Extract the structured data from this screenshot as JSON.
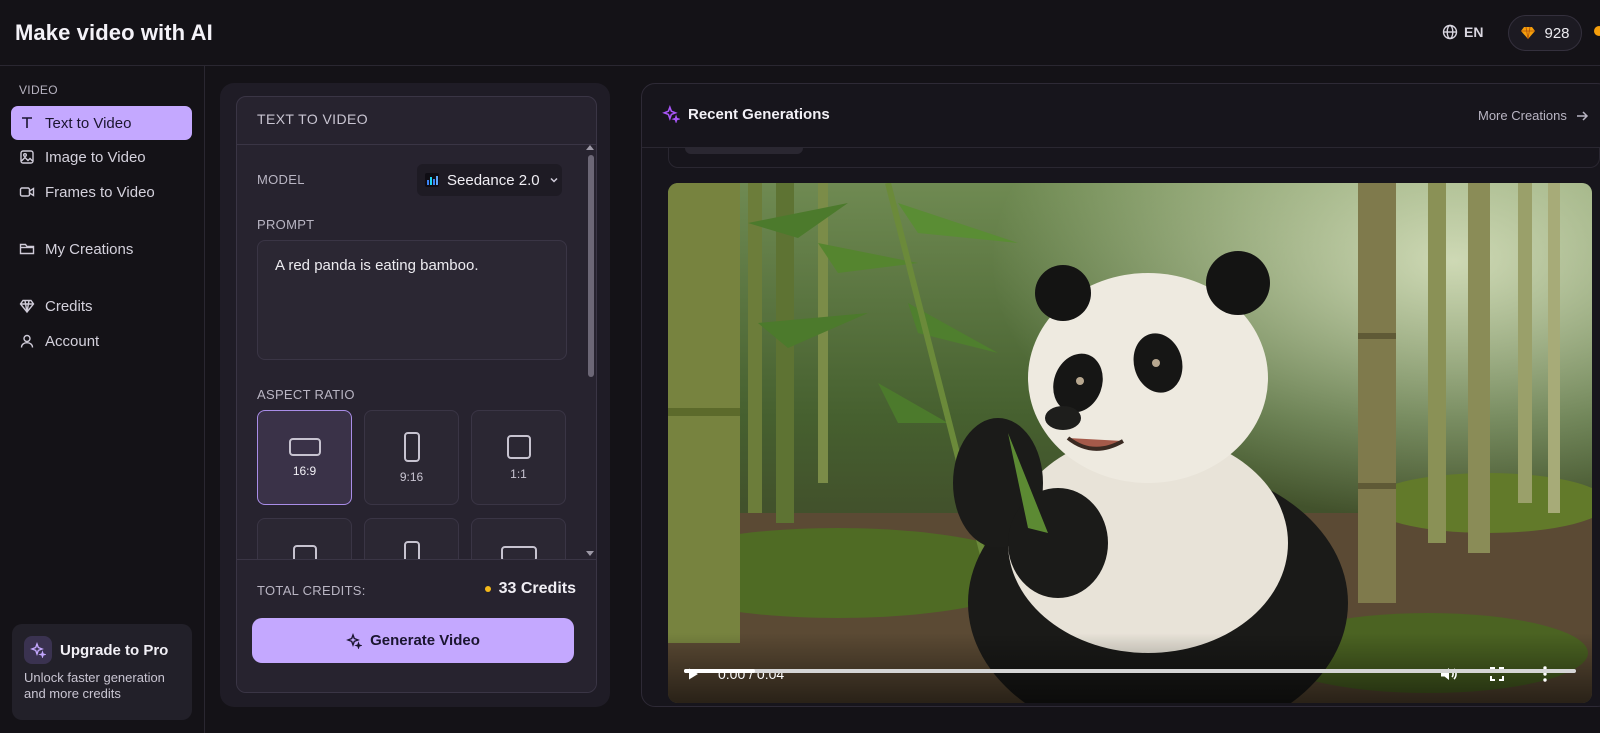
{
  "header": {
    "title": "Make video with AI",
    "language": "EN",
    "credits_balance": "928"
  },
  "sidebar": {
    "section_label": "VIDEO",
    "items": [
      {
        "label": "Text to Video",
        "icon": "text-icon",
        "active": true
      },
      {
        "label": "Image to Video",
        "icon": "image-icon",
        "active": false
      },
      {
        "label": "Frames to Video",
        "icon": "video-camera-icon",
        "active": false
      },
      {
        "label": "My Creations",
        "icon": "folder-icon",
        "active": false
      },
      {
        "label": "Credits",
        "icon": "diamond-icon",
        "active": false
      },
      {
        "label": "Account",
        "icon": "user-icon",
        "active": false
      }
    ],
    "upgrade": {
      "title": "Upgrade to Pro",
      "subtitle": "Unlock faster generation and more credits"
    }
  },
  "panel": {
    "title": "TEXT TO VIDEO",
    "model_label": "MODEL",
    "model_value": "Seedance 2.0",
    "prompt_label": "PROMPT",
    "prompt_value": "A red panda is eating bamboo.",
    "aspect_label": "ASPECT RATIO",
    "aspect_options": [
      "16:9",
      "9:16",
      "1:1"
    ],
    "aspect_selected": "16:9",
    "total_credits_label": "TOTAL CREDITS:",
    "total_credits_value": "33 Credits",
    "generate_label": "Generate Video"
  },
  "recent": {
    "title": "Recent Generations",
    "more_label": "More Creations",
    "video": {
      "time": "0:00 / 0:04",
      "progress": 0.08
    }
  },
  "colors": {
    "accent": "#c4a8ff",
    "background": "#141217",
    "credit_dot": "#f5b91a"
  }
}
